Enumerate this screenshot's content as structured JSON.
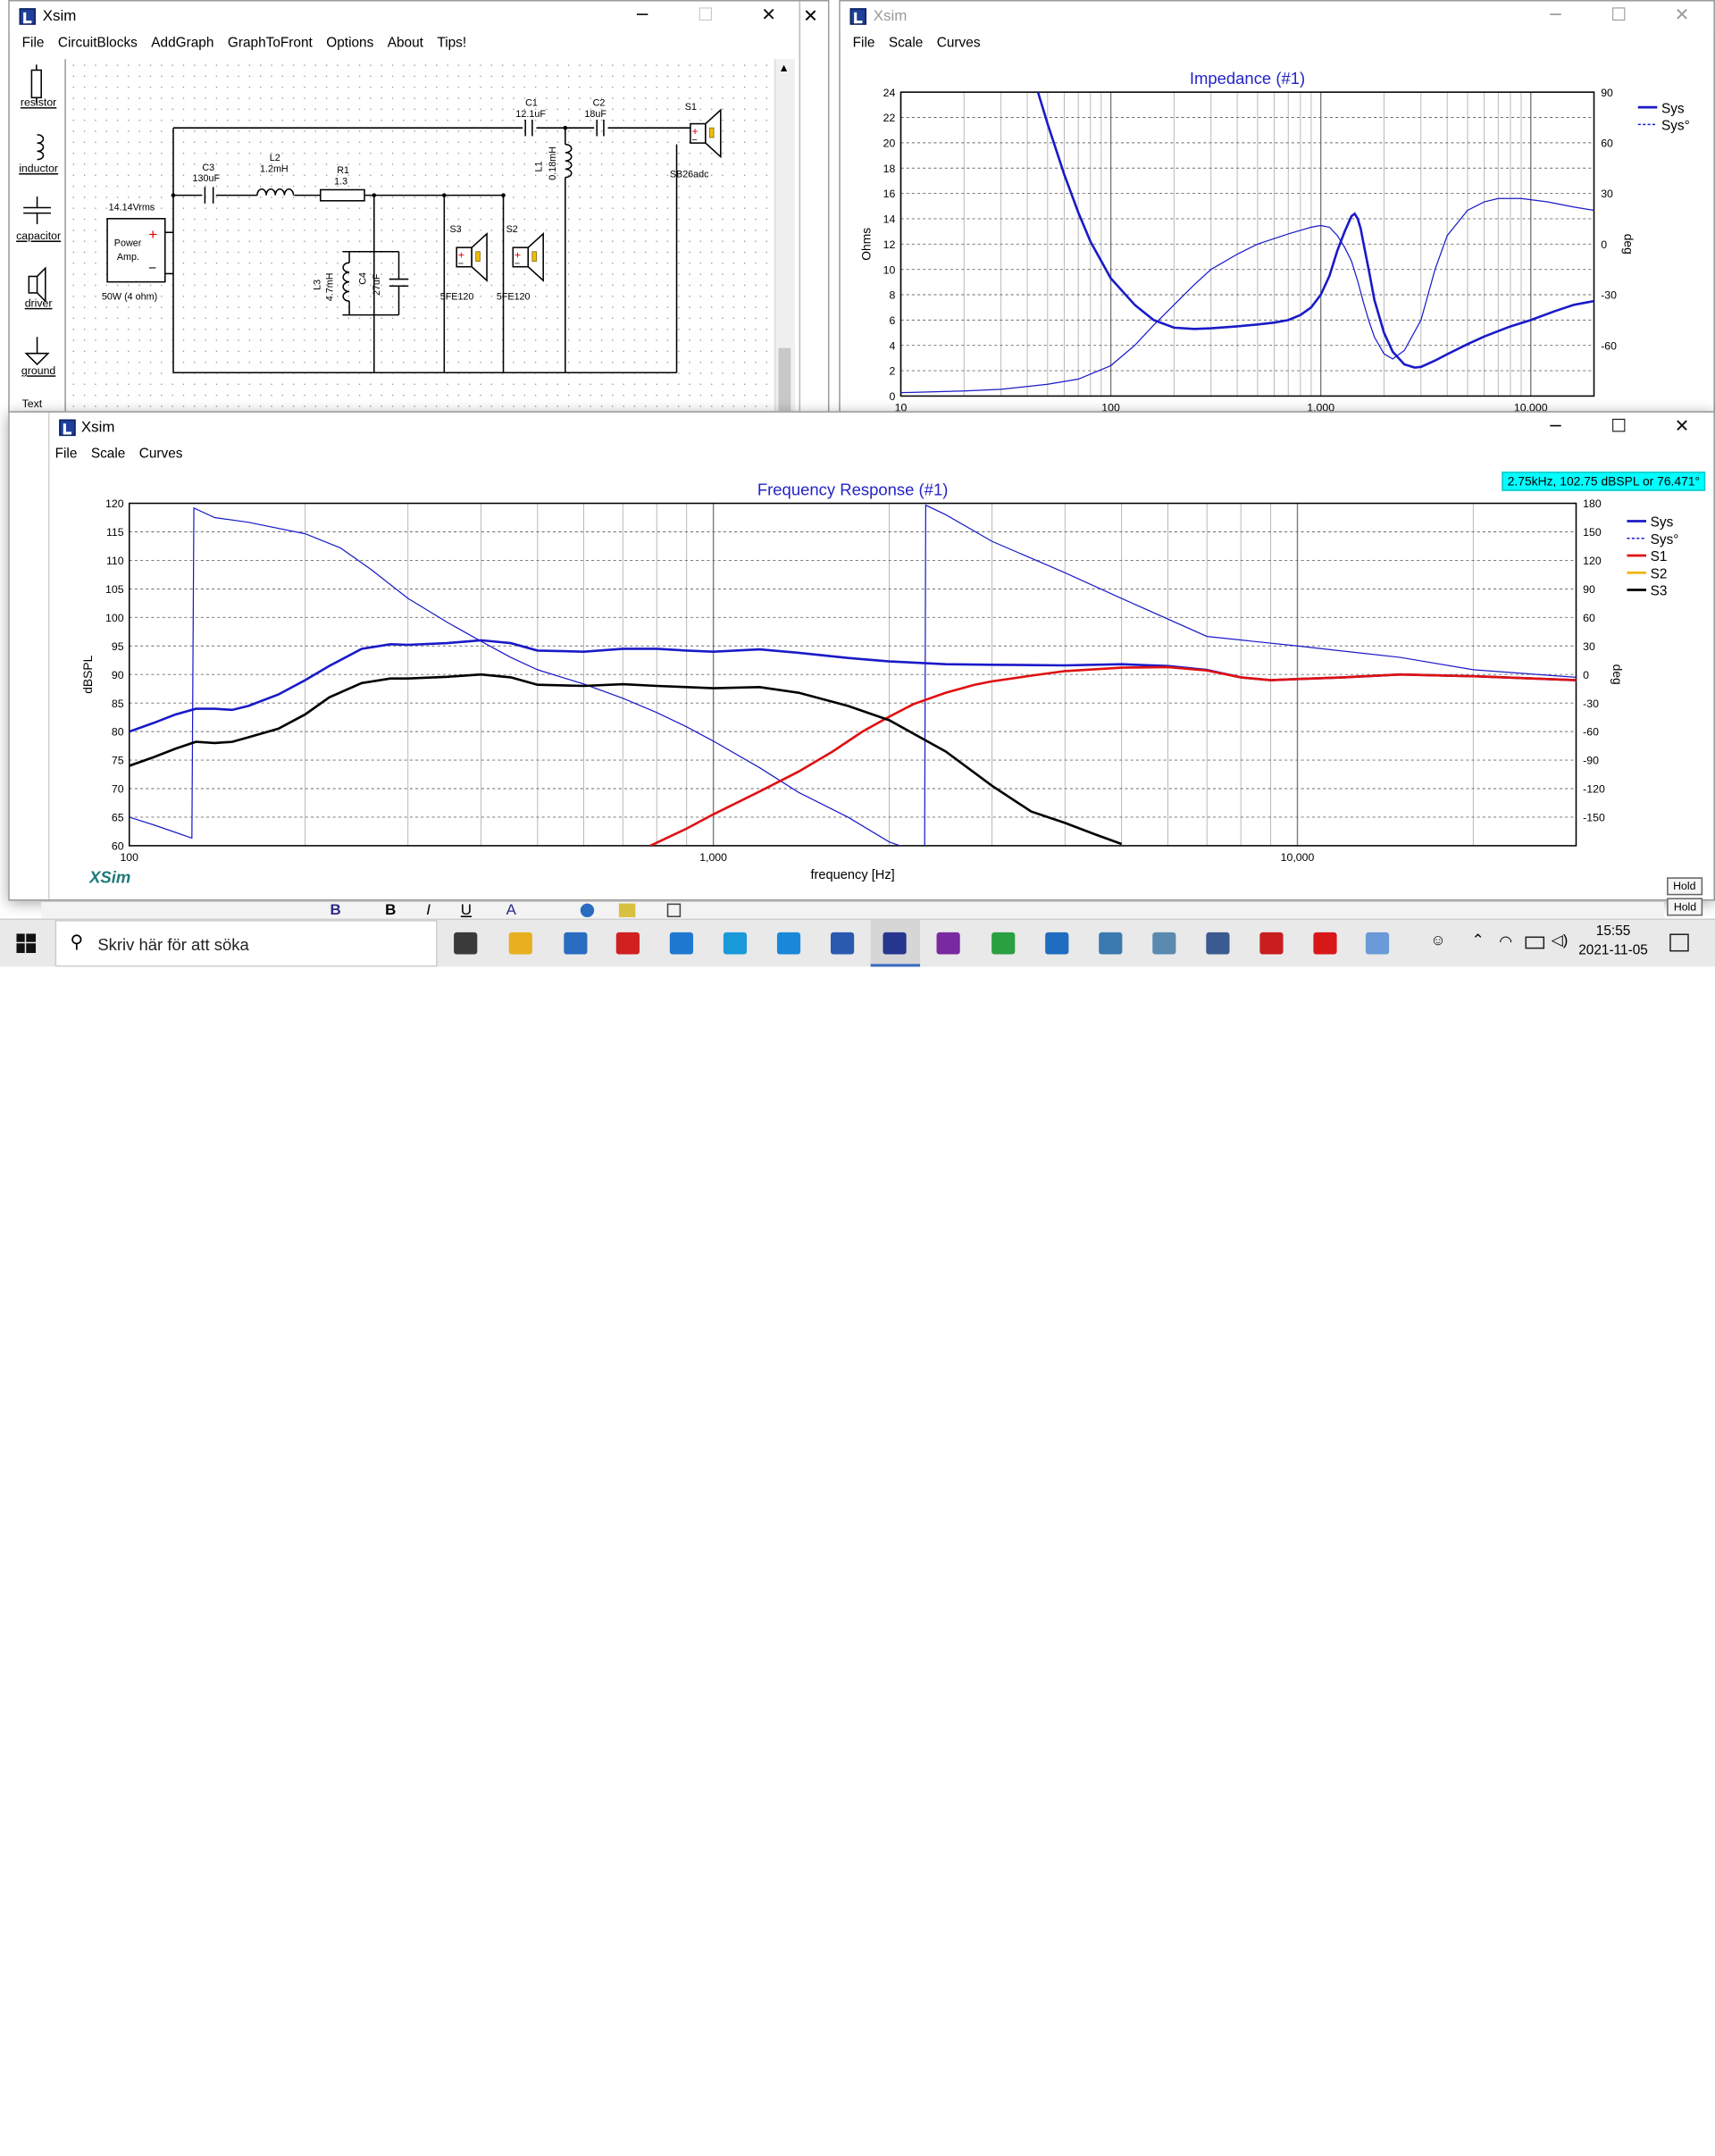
{
  "windows": {
    "circuit": {
      "title": "Xsim",
      "menu": [
        "File",
        "CircuitBlocks",
        "AddGraph",
        "GraphToFront",
        "Options",
        "About",
        "Tips!"
      ],
      "palette": [
        "resistor",
        "inductor",
        "capacitor",
        "driver",
        "ground",
        "Text",
        "Text"
      ],
      "labels": {
        "c1": "C1",
        "c1v": "12.1uF",
        "c2": "C2",
        "c2v": "18uF",
        "s1": "S1",
        "s1m": "SB26adc",
        "c3": "C3",
        "c3v": "130uF",
        "l2": "L2",
        "l2v": "1.2mH",
        "r1": "R1",
        "r1v": "1.3",
        "l1": "L1",
        "l1v": "0.18mH",
        "amp_v": "14.14Vrms",
        "amp_1": "Power",
        "amp_2": "Amp.",
        "amp_w": "50W (4 ohm)",
        "l3": "L3",
        "l3v": "4.7mH",
        "c4": "C4",
        "c4v": "27uF",
        "s3": "S3",
        "s2": "S2",
        "s3m": "5FE120",
        "s2m": "5FE120"
      }
    },
    "impedance": {
      "title": "Xsim",
      "menu": [
        "File",
        "Scale",
        "Curves"
      ]
    },
    "frequency": {
      "title": "Xsim",
      "menu": [
        "File",
        "Scale",
        "Curves"
      ],
      "readout": "2.75kHz, 102.75 dBSPL or 76.471°",
      "logo": "XSim",
      "hold": "Hold",
      "hold2": "Hold"
    }
  },
  "taskbar": {
    "search_placeholder": "Skriv här för att söka",
    "time": "15:55",
    "date": "2021-11-05"
  },
  "colors": {
    "curve_sys": "#1a1ac8",
    "curve_s1": "#e01010",
    "curve_s2": "#f0b400",
    "curve_s3": "#000000",
    "title_blue": "#2424c8",
    "readout_bg": "#00ffff"
  },
  "chart_data": [
    {
      "type": "line",
      "title": "Impedance (#1)",
      "xlabel": "",
      "ylabel": "Ohms",
      "y2label": "deg",
      "x_scale": "log",
      "xlim": [
        10,
        20000
      ],
      "ylim": [
        0,
        24
      ],
      "y2lim": [
        -90,
        90
      ],
      "x_ticks": [
        "10",
        "100",
        "1,000",
        "10,000"
      ],
      "y_ticks": [
        "0",
        "2",
        "4",
        "6",
        "8",
        "10",
        "12",
        "14",
        "16",
        "18",
        "20",
        "22",
        "24"
      ],
      "y2_ticks": [
        "90",
        "60",
        "30",
        "0",
        "-30",
        "-60"
      ],
      "grid": true,
      "legend": "top-right",
      "series": [
        {
          "name": "Sys",
          "style": "solid",
          "x": [
            45,
            50,
            60,
            70,
            80,
            100,
            130,
            160,
            200,
            250,
            300,
            400,
            500,
            600,
            700,
            800,
            900,
            1000,
            1100,
            1200,
            1300,
            1400,
            1450,
            1500,
            1550,
            1600,
            1700,
            1800,
            2000,
            2200,
            2500,
            2800,
            3000,
            3500,
            4000,
            5000,
            6000,
            8000,
            10000,
            13000,
            16000,
            20000
          ],
          "y": [
            24,
            21.5,
            17.5,
            14.5,
            12.2,
            9.3,
            7.2,
            6.0,
            5.4,
            5.3,
            5.35,
            5.5,
            5.65,
            5.8,
            6.0,
            6.4,
            7.0,
            8.0,
            9.5,
            11.5,
            13.0,
            14.2,
            14.4,
            14.0,
            13.2,
            12.0,
            9.8,
            7.6,
            5.0,
            3.5,
            2.5,
            2.25,
            2.3,
            2.8,
            3.3,
            4.1,
            4.7,
            5.5,
            6.0,
            6.7,
            7.2,
            7.5
          ]
        },
        {
          "name": "Sys°",
          "style": "thin",
          "x": [
            10,
            20,
            30,
            50,
            70,
            100,
            130,
            160,
            200,
            250,
            300,
            400,
            500,
            700,
            900,
            1000,
            1100,
            1200,
            1300,
            1400,
            1500,
            1600,
            1700,
            1800,
            2000,
            2200,
            2500,
            3000,
            3500,
            4000,
            5000,
            6000,
            7000,
            9000,
            12000,
            16000,
            20000
          ],
          "y": [
            -88,
            -87,
            -86,
            -83,
            -80,
            -72,
            -60,
            -48,
            -36,
            -24,
            -15,
            -6,
            0,
            6,
            10,
            11,
            10,
            5,
            -2,
            -10,
            -22,
            -35,
            -46,
            -55,
            -65,
            -68,
            -63,
            -45,
            -15,
            5,
            20,
            25,
            27,
            27,
            25,
            22,
            20
          ]
        }
      ]
    },
    {
      "type": "line",
      "title": "Frequency Response (#1)",
      "xlabel": "frequency [Hz]",
      "ylabel": "dBSPL",
      "y2label": "deg",
      "x_scale": "log",
      "xlim": [
        100,
        30000
      ],
      "ylim": [
        60,
        120
      ],
      "y2lim": [
        -180,
        180
      ],
      "x_ticks": [
        "100",
        "1,000",
        "10,000"
      ],
      "y_ticks": [
        "60",
        "65",
        "70",
        "75",
        "80",
        "85",
        "90",
        "95",
        "100",
        "105",
        "110",
        "115",
        "120"
      ],
      "y2_ticks": [
        "180",
        "150",
        "120",
        "90",
        "60",
        "30",
        "0",
        "-30",
        "-60",
        "-90",
        "-120",
        "-150"
      ],
      "grid": true,
      "legend": "top-right",
      "series": [
        {
          "name": "Sys",
          "style": "solid",
          "x": [
            100,
            110,
            120,
            130,
            140,
            150,
            160,
            180,
            200,
            220,
            250,
            280,
            300,
            350,
            400,
            450,
            500,
            600,
            700,
            800,
            900,
            1000,
            1200,
            1400,
            1700,
            2000,
            2500,
            3000,
            4000,
            5000,
            6000,
            7000,
            8000,
            9000,
            10000,
            12000,
            15000,
            20000,
            30000
          ],
          "y": [
            80,
            81.5,
            83,
            84,
            84,
            83.8,
            84.5,
            86.5,
            89,
            91.5,
            94.5,
            95.3,
            95.2,
            95.5,
            96,
            95.5,
            94.2,
            94,
            94.5,
            94.5,
            94.2,
            94,
            94.4,
            93.8,
            92.9,
            92.3,
            91.8,
            91.7,
            91.6,
            91.8,
            91.5,
            90.8,
            89.5,
            89,
            89.2,
            89.5,
            90,
            89.7,
            89
          ]
        },
        {
          "name": "Sys°",
          "style": "thin",
          "x": [
            100,
            110,
            120,
            128,
            129,
            140,
            160,
            200,
            230,
            260,
            300,
            350,
            400,
            450,
            500,
            600,
            700,
            800,
            900,
            1000,
            1200,
            1400,
            1700,
            2000,
            2200,
            2300,
            2310,
            2500,
            3000,
            4000,
            5000,
            7000,
            10000,
            15000,
            20000,
            30000
          ],
          "y": [
            -150,
            -158,
            -166,
            -172,
            175,
            165,
            160,
            148,
            133,
            110,
            80,
            55,
            35,
            18,
            5,
            -10,
            -25,
            -40,
            -55,
            -70,
            -98,
            -124,
            -150,
            -176,
            -185,
            -190,
            178,
            168,
            140,
            107,
            80,
            40,
            30,
            18,
            5,
            -3
          ]
        },
        {
          "name": "S1",
          "style": "solid",
          "x": [
            780,
            900,
            1000,
            1200,
            1400,
            1600,
            1800,
            2000,
            2200,
            2500,
            2800,
            3000,
            3500,
            4000,
            5000,
            6000,
            7000,
            8000,
            9000,
            10000,
            12000,
            15000,
            20000,
            30000
          ],
          "y": [
            60,
            63,
            65.5,
            69.5,
            73,
            76.5,
            80,
            82.6,
            84.8,
            86.8,
            88.2,
            88.8,
            89.8,
            90.6,
            91.2,
            91.3,
            90.7,
            89.5,
            89,
            89.2,
            89.5,
            90,
            89.7,
            89
          ]
        },
        {
          "name": "S2",
          "style": "solid",
          "x": [],
          "y": []
        },
        {
          "name": "S3",
          "style": "solid",
          "x": [
            100,
            110,
            120,
            130,
            140,
            150,
            160,
            180,
            200,
            220,
            250,
            280,
            300,
            350,
            400,
            450,
            500,
            600,
            700,
            800,
            900,
            1000,
            1200,
            1400,
            1700,
            2000,
            2500,
            3000,
            3500,
            4000,
            4500,
            5000
          ],
          "y": [
            74,
            75.5,
            77,
            78.2,
            78,
            78.2,
            79,
            80.5,
            83,
            86,
            88.5,
            89.3,
            89.3,
            89.6,
            90,
            89.5,
            88.2,
            88,
            88.3,
            88,
            87.8,
            87.6,
            87.8,
            86.8,
            84.5,
            82,
            76.5,
            70.5,
            66,
            64,
            62,
            60.3
          ]
        }
      ]
    }
  ]
}
